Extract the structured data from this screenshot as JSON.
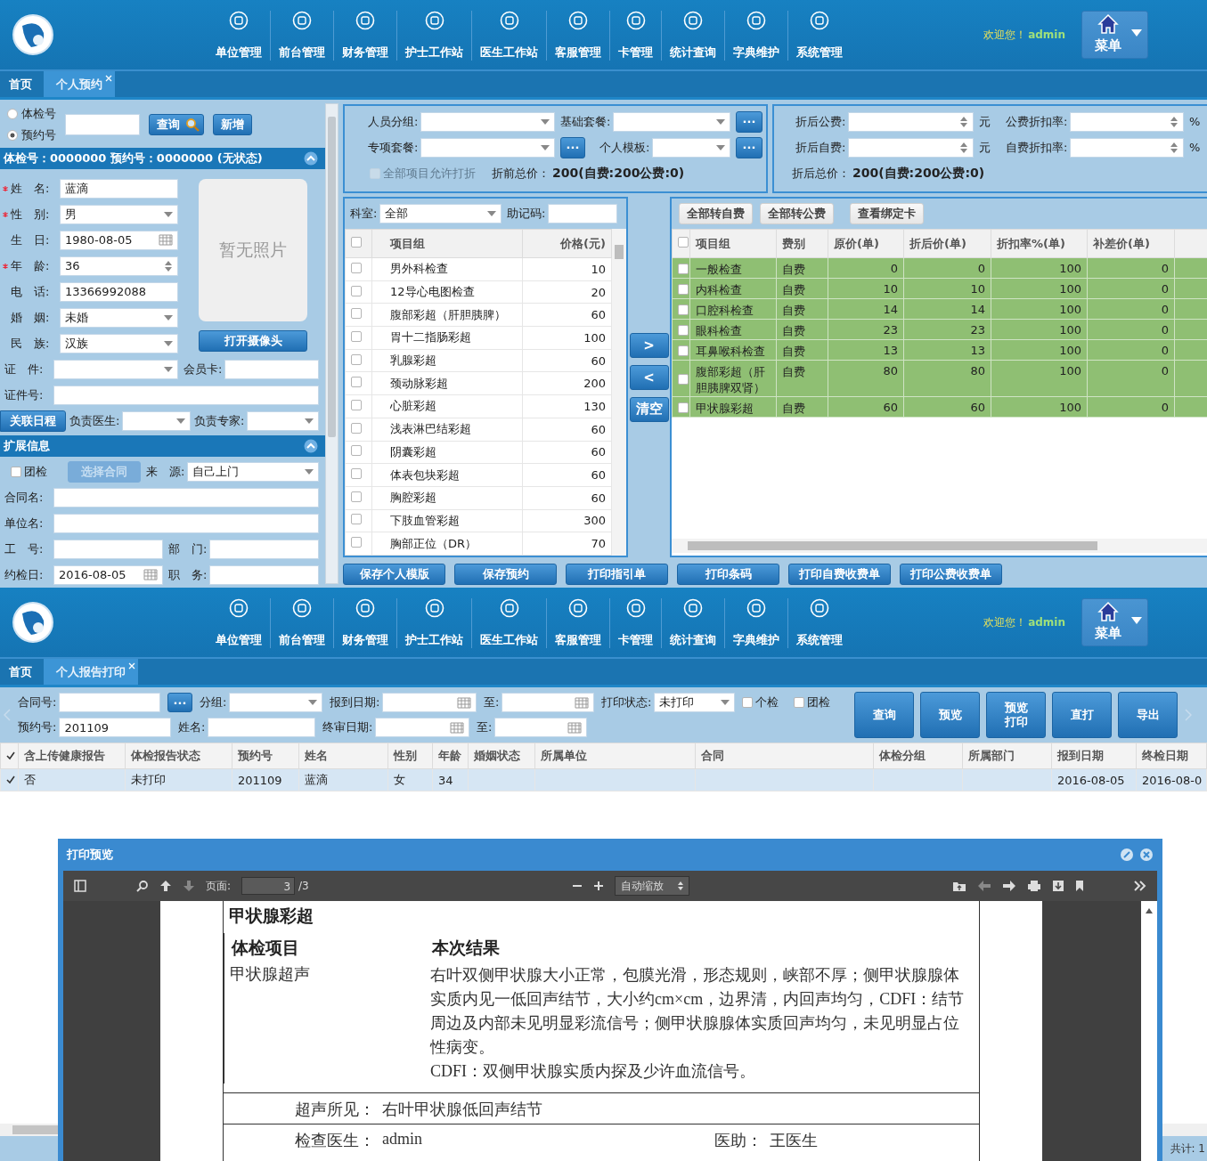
{
  "screens": [
    {
      "kind": "appointment",
      "header": {
        "nav": [
          "单位管理",
          "前台管理",
          "财务管理",
          "护士工作站",
          "医生工作站",
          "客服管理",
          "卡管理",
          "统计查询",
          "字典维护",
          "系统管理"
        ],
        "welcome": "欢迎您！",
        "user": "admin",
        "menu": "菜单"
      },
      "tabs": [
        {
          "label": "首页",
          "selected": false,
          "closable": false
        },
        {
          "label": "个人预约",
          "selected": true,
          "closable": true
        }
      ],
      "search": {
        "modes": [
          {
            "label": "体检号",
            "selected": false
          },
          {
            "label": "预约号",
            "selected": true
          }
        ],
        "query_button": "查询",
        "new_button": "新增"
      },
      "basic_header": "体检号：0000000 预约号：0000000 (无状态)",
      "basic_fields": [
        {
          "kind": "text",
          "label": "姓　名:",
          "value": "蓝滴",
          "required": true
        },
        {
          "kind": "select",
          "label": "性　别:",
          "value": "男",
          "required": true
        },
        {
          "kind": "date",
          "label": "生　日:",
          "value": "1980-08-05",
          "required": false
        },
        {
          "kind": "spinner",
          "label": "年　龄:",
          "value": "36",
          "required": true
        },
        {
          "kind": "text",
          "label": "电　话:",
          "value": "13366992088",
          "required": false
        },
        {
          "kind": "select",
          "label": "婚　姻:",
          "value": "未婚",
          "required": false
        },
        {
          "kind": "select",
          "label": "民　族:",
          "value": "汉族",
          "required": false
        }
      ],
      "photo": {
        "text": "暂无照片",
        "button": "打开摄像头"
      },
      "basic_rows": [
        [
          {
            "kind": "select",
            "label": "证　件:"
          },
          {
            "kind": "text",
            "label": "会员卡:"
          }
        ],
        [
          {
            "kind": "text",
            "label": "证件号:"
          }
        ],
        [
          {
            "kind": "button",
            "label": "关联日程"
          },
          {
            "kind": "select",
            "label": "负责医生:"
          },
          {
            "kind": "select",
            "label": "负责专家:"
          }
        ]
      ],
      "extra_header": "扩展信息",
      "extra_rows": [
        [
          {
            "kind": "checkbox",
            "label": "团检",
            "checked": false,
            "disabled": false
          },
          {
            "kind": "button",
            "label": "选择合同",
            "disabled": true
          },
          {
            "kind": "select",
            "label": "来　源:",
            "value": "自己上门"
          }
        ],
        [
          {
            "kind": "text",
            "label": "合同名:"
          }
        ],
        [
          {
            "kind": "text",
            "label": "单位名:"
          }
        ],
        [
          {
            "kind": "text",
            "label": "工　号:"
          },
          {
            "kind": "text",
            "label": "部　门:"
          }
        ],
        [
          {
            "kind": "date",
            "label": "约检日:",
            "value": "2016-08-05"
          },
          {
            "kind": "text",
            "label": "职　务:"
          }
        ]
      ],
      "package_rows": [
        [
          {
            "kind": "select",
            "label": "人员分组:"
          },
          {
            "kind": "select",
            "label": "基础套餐:"
          },
          {
            "kind": "dots",
            "label": "···"
          }
        ],
        [
          {
            "kind": "select",
            "label": "专项套餐:"
          },
          {
            "kind": "dots",
            "label": "···"
          },
          {
            "kind": "select",
            "label": "个人模板:"
          },
          {
            "kind": "dots",
            "label": "···"
          }
        ],
        [
          {
            "kind": "checkbox",
            "label": "全部项目允许打折",
            "checked": false,
            "disabled": true
          },
          {
            "kind": "total",
            "label": "折前总价：",
            "value": "200(自费:200公费:0)"
          }
        ]
      ],
      "discount_rows": [
        [
          {
            "kind": "spinner",
            "label": "折后公费:"
          },
          {
            "kind": "unit",
            "label": "元"
          },
          {
            "kind": "spinner",
            "label": "公费折扣率:"
          },
          {
            "kind": "unit",
            "label": "%"
          }
        ],
        [
          {
            "kind": "spinner",
            "label": "折后自费:"
          },
          {
            "kind": "unit",
            "label": "元"
          },
          {
            "kind": "spinner",
            "label": "自费折扣率:"
          },
          {
            "kind": "unit",
            "label": "%"
          }
        ],
        [
          {
            "kind": "total",
            "label": "折后总价：",
            "value": "200(自费:200公费:0)"
          }
        ]
      ],
      "available": {
        "filters": [
          {
            "kind": "select",
            "label": "科室:",
            "value": "全部"
          },
          {
            "kind": "text",
            "label": "助记码:"
          }
        ],
        "all_checked": false,
        "columns": [
          "项目组",
          "价格(元)"
        ],
        "rows": [
          {
            "name": "男外科检查",
            "price": "10",
            "checked": false
          },
          {
            "name": "12导心电图检查",
            "price": "20",
            "checked": false
          },
          {
            "name": "腹部彩超（肝胆胰脾）",
            "price": "60",
            "checked": false
          },
          {
            "name": "胃十二指肠彩超",
            "price": "100",
            "checked": false
          },
          {
            "name": "乳腺彩超",
            "price": "60",
            "checked": false
          },
          {
            "name": "颈动脉彩超",
            "price": "200",
            "checked": false
          },
          {
            "name": "心脏彩超",
            "price": "130",
            "checked": false
          },
          {
            "name": "浅表淋巴结彩超",
            "price": "60",
            "checked": false
          },
          {
            "name": "阴囊彩超",
            "price": "60",
            "checked": false
          },
          {
            "name": "体表包块彩超",
            "price": "60",
            "checked": false
          },
          {
            "name": "胸腔彩超",
            "price": "60",
            "checked": false
          },
          {
            "name": "下肢血管彩超",
            "price": "300",
            "checked": false
          },
          {
            "name": "胸部正位（DR）",
            "price": "70",
            "checked": false
          }
        ]
      },
      "move_buttons": [
        ">",
        "<",
        "清空"
      ],
      "selected_items": {
        "actions": [
          "全部转自费",
          "全部转公费",
          "查看绑定卡"
        ],
        "all_checked": false,
        "columns": [
          "项目组",
          "费别",
          "原价(单)",
          "折后价(单)",
          "折扣率%(单)",
          "补差价(单)"
        ],
        "rows": [
          {
            "checked": false,
            "cells": [
              "一般检查",
              "自费",
              "0",
              "0",
              "100",
              "0"
            ]
          },
          {
            "checked": false,
            "cells": [
              "内科检查",
              "自费",
              "10",
              "10",
              "100",
              "0"
            ]
          },
          {
            "checked": false,
            "cells": [
              "口腔科检查",
              "自费",
              "14",
              "14",
              "100",
              "0"
            ]
          },
          {
            "checked": false,
            "cells": [
              "眼科检查",
              "自费",
              "23",
              "23",
              "100",
              "0"
            ]
          },
          {
            "checked": false,
            "cells": [
              "耳鼻喉科检查",
              "自费",
              "13",
              "13",
              "100",
              "0"
            ]
          },
          {
            "checked": false,
            "cells": [
              "腹部彩超（肝胆胰脾双肾）",
              "自费",
              "80",
              "80",
              "100",
              "0"
            ]
          },
          {
            "checked": false,
            "cells": [
              "甲状腺彩超",
              "自费",
              "60",
              "60",
              "100",
              "0"
            ]
          }
        ]
      },
      "actions": [
        "保存个人模版",
        "保存预约",
        "打印指引单",
        "打印条码",
        "打印自费收费单",
        "打印公费收费单"
      ]
    },
    {
      "kind": "report_print",
      "header": {
        "nav": [
          "单位管理",
          "前台管理",
          "财务管理",
          "护士工作站",
          "医生工作站",
          "客服管理",
          "卡管理",
          "统计查询",
          "字典维护",
          "系统管理"
        ],
        "welcome": "欢迎您！",
        "user": "admin",
        "menu": "菜单"
      },
      "tabs": [
        {
          "label": "首页",
          "selected": false,
          "closable": false
        },
        {
          "label": "个人报告打印",
          "selected": true,
          "closable": true
        }
      ],
      "filter_rows": [
        [
          {
            "kind": "text",
            "label": "合同号:"
          },
          {
            "kind": "dots",
            "label": "···"
          },
          {
            "kind": "select",
            "label": "分组:"
          },
          {
            "kind": "date",
            "label": "报到日期:"
          },
          {
            "kind": "date",
            "label": "至:"
          },
          {
            "kind": "select",
            "label": "打印状态:",
            "value": "未打印"
          },
          {
            "kind": "checkbox",
            "label": "个检",
            "checked": false,
            "disabled": false
          },
          {
            "kind": "checkbox",
            "label": "团检",
            "checked": false,
            "disabled": false
          }
        ],
        [
          {
            "kind": "text",
            "label": "预约号:",
            "value": "201109"
          },
          {
            "kind": "text",
            "label": "姓名:"
          },
          {
            "kind": "date",
            "label": "终审日期:"
          },
          {
            "kind": "date",
            "label": "至:"
          }
        ]
      ],
      "buttons": [
        "查询",
        "预览",
        "预览打印",
        "直打",
        "导出"
      ],
      "table": {
        "all_checked": true,
        "columns": [
          "含上传健康报告",
          "体检报告状态",
          "预约号",
          "姓名",
          "性别",
          "年龄",
          "婚姻状态",
          "所属单位",
          "合同",
          "体检分组",
          "所属部门",
          "报到日期",
          "终检日期"
        ],
        "rows": [
          {
            "checked": true,
            "cells": [
              "否",
              "未打印",
              "201109",
              "蓝滴",
              "女",
              "34",
              "",
              "",
              "",
              "",
              "",
              "2016-08-05",
              "2016-08-0"
            ]
          }
        ]
      },
      "pager": {
        "total": "共计: 1"
      },
      "preview": {
        "title": "打印预览",
        "page_label": "页面:",
        "page": "3",
        "page_count": "/3",
        "zoom": "自动缩放",
        "document": {
          "title": "甲状腺彩超",
          "columns": [
            "体检项目",
            "本次结果"
          ],
          "item": "甲状腺超声",
          "result": [
            "右叶双侧甲状腺大小正常，包膜光滑，形态规则，峡部不厚；侧甲状腺腺体实质内见一低回声结节，大小约cm×cm，边界清，内回声均匀，CDFI：结节周边及内部未见明显彩流信号；侧甲状腺腺体实质回声均匀，未见明显占位性病变。",
            "CDFI：双侧甲状腺实质内探及少许血流信号。"
          ],
          "finding_label": "超声所见：",
          "finding": "右叶甲状腺低回声结节",
          "doctor_label": "检查医生：",
          "doctor": "admin",
          "assistant_label": "医助：",
          "assistant": "王医生"
        }
      }
    }
  ]
}
